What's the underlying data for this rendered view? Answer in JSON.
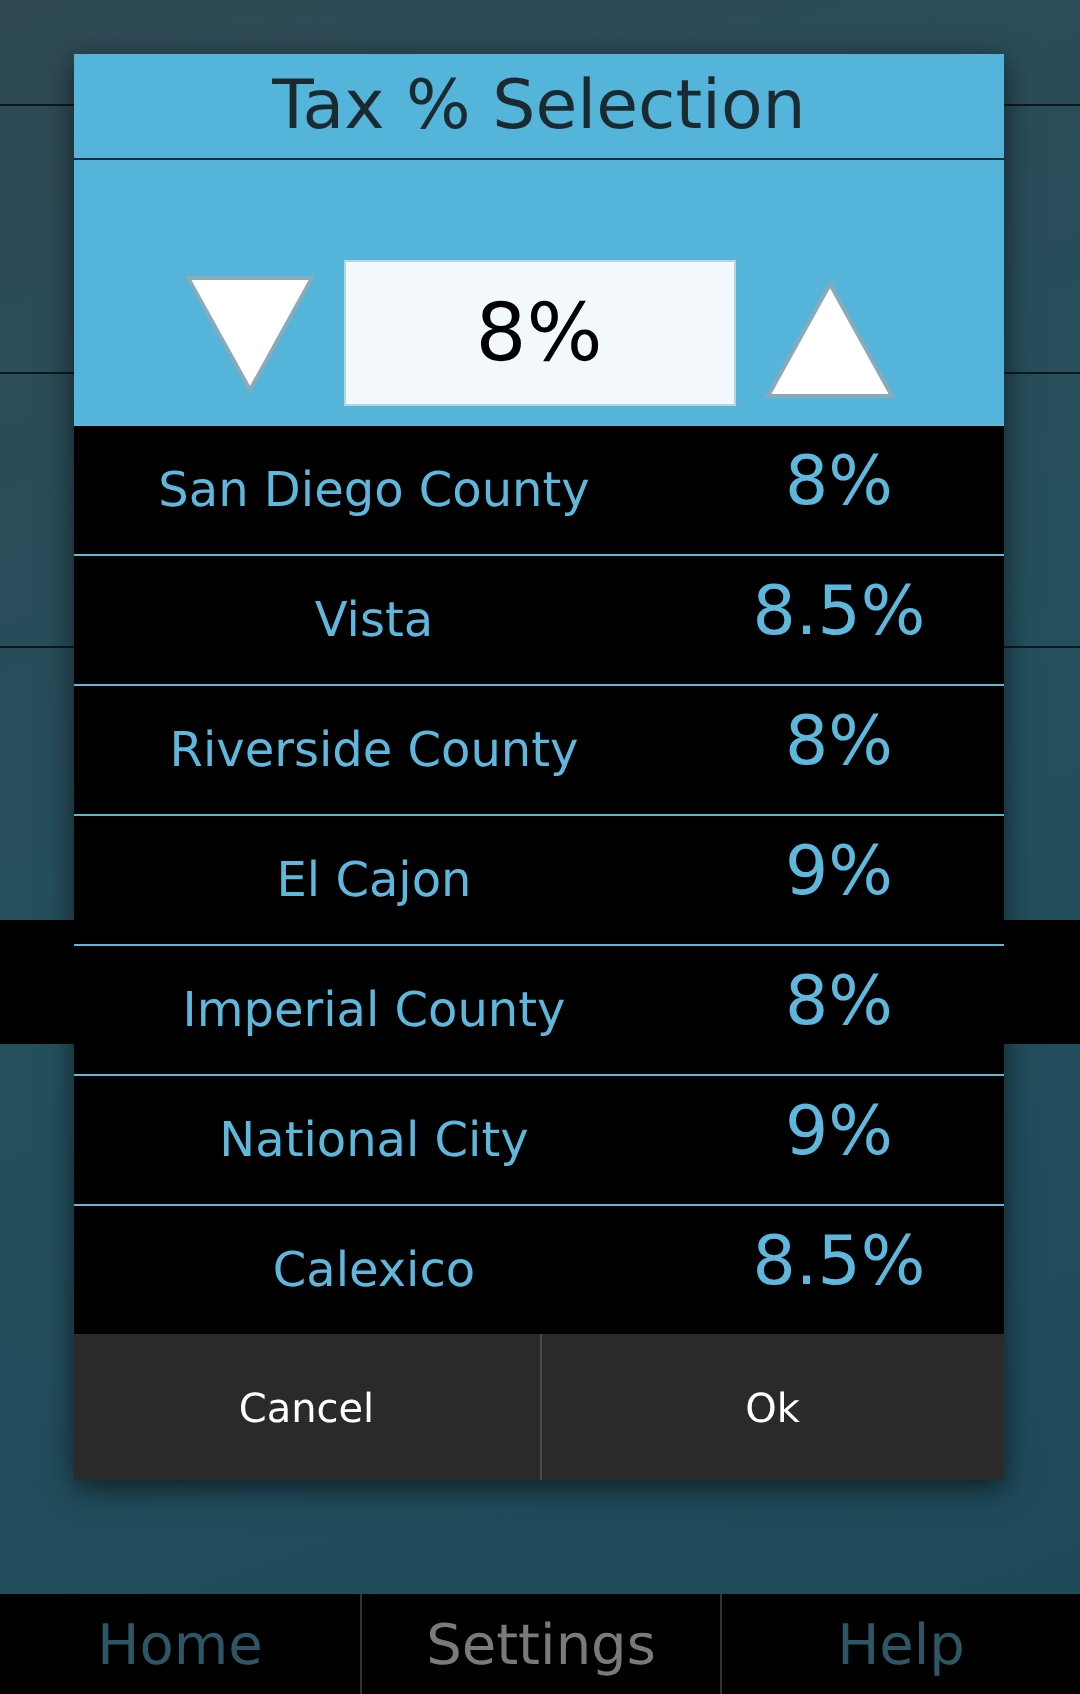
{
  "dialog": {
    "title": "Tax % Selection",
    "stepper": {
      "value": "8%"
    },
    "rates": [
      {
        "name": "San Diego County",
        "rate": "8%"
      },
      {
        "name": "Vista",
        "rate": "8.5%"
      },
      {
        "name": "Riverside County",
        "rate": "8%"
      },
      {
        "name": "El Cajon",
        "rate": "9%"
      },
      {
        "name": "Imperial County",
        "rate": "8%"
      },
      {
        "name": "National City",
        "rate": "9%"
      },
      {
        "name": "Calexico",
        "rate": "8.5%"
      }
    ],
    "buttons": [
      "Cancel",
      "Ok"
    ]
  },
  "tabs": [
    {
      "label": "Home",
      "selected": false
    },
    {
      "label": "Settings",
      "selected": true
    },
    {
      "label": "Help",
      "selected": false
    }
  ]
}
